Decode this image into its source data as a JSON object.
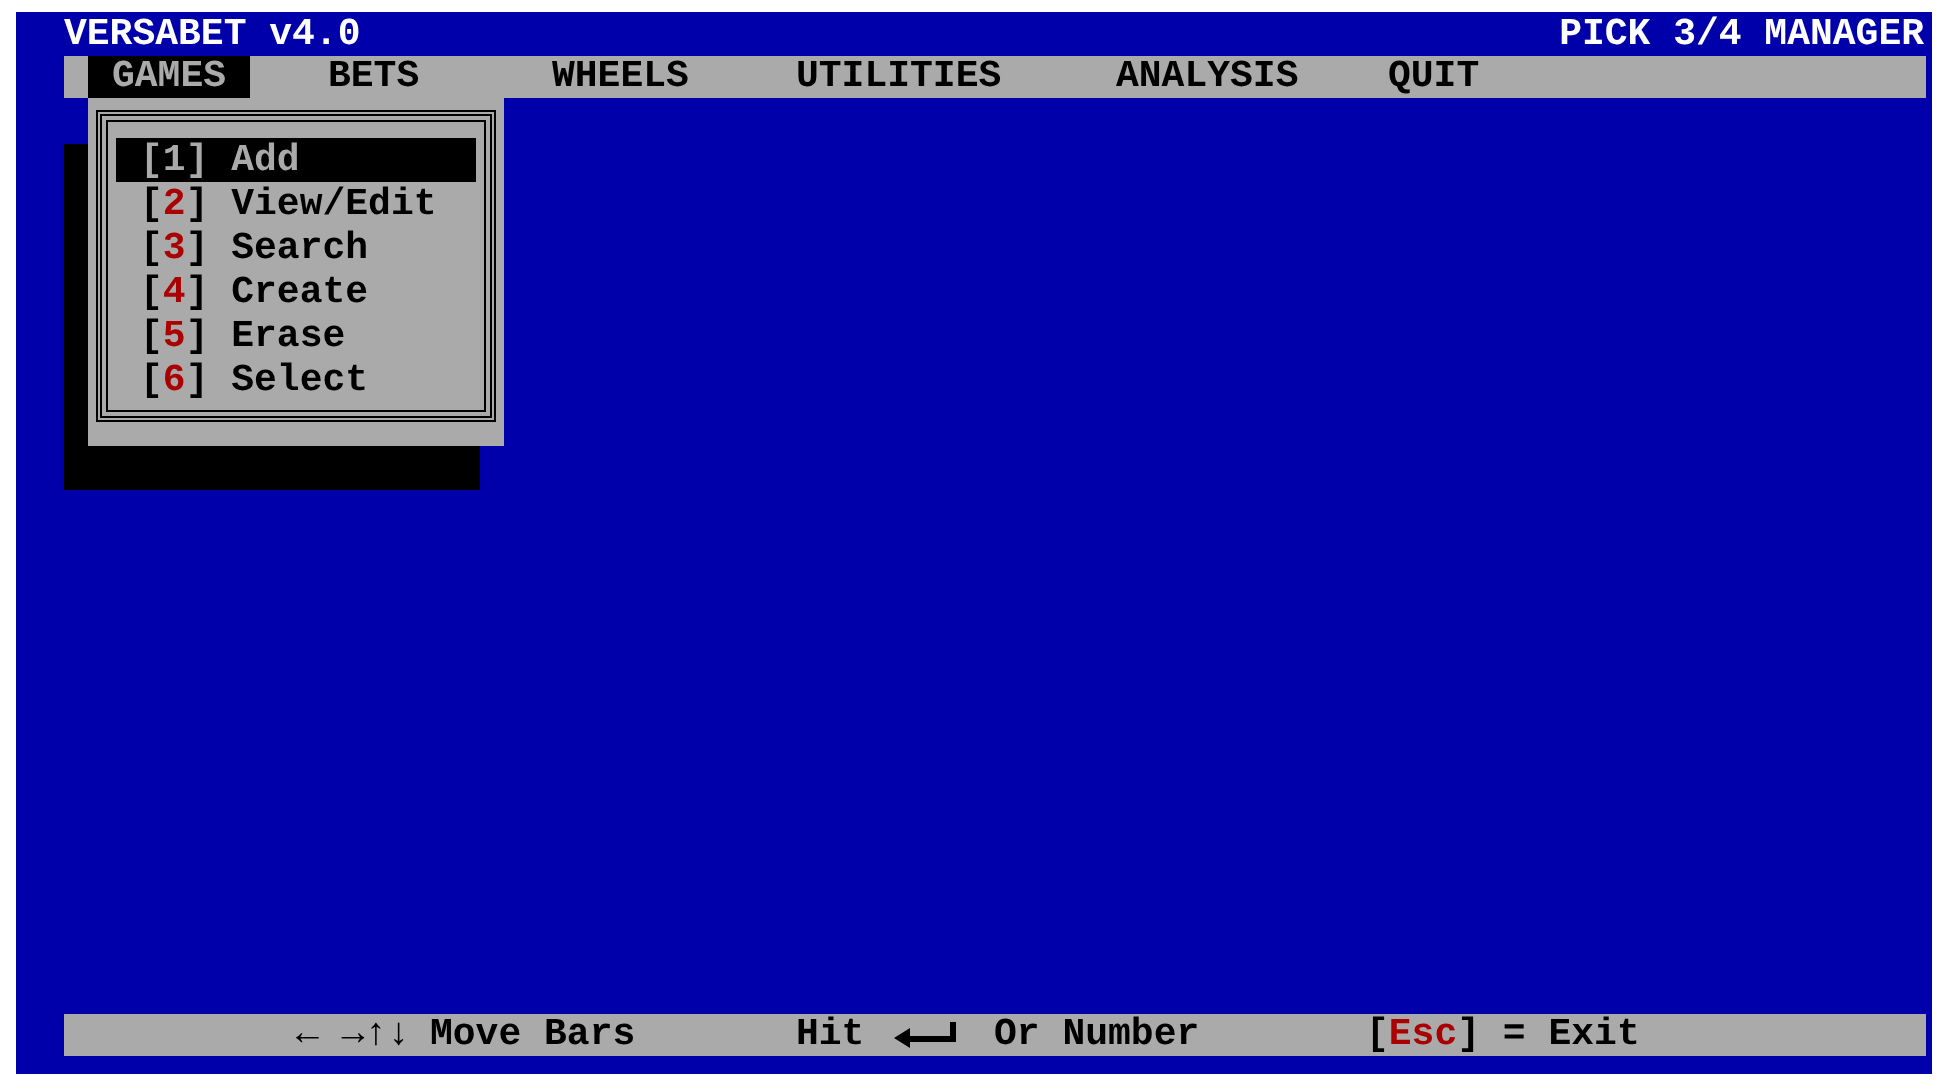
{
  "title_left": "VERSABET v4.0",
  "title_right": "PICK 3/4 MANAGER",
  "menu": [
    {
      "label": "GAMES",
      "selected": true
    },
    {
      "label": "BETS",
      "selected": false
    },
    {
      "label": "WHEELS",
      "selected": false
    },
    {
      "label": "UTILITIES",
      "selected": false
    },
    {
      "label": "ANALYSIS",
      "selected": false
    },
    {
      "label": "QUIT",
      "selected": false
    }
  ],
  "dropdown": [
    {
      "open": "[",
      "key": "1",
      "close": "]",
      "label": "Add",
      "selected": true
    },
    {
      "open": "[",
      "key": "2",
      "close": "]",
      "label": "View/Edit",
      "selected": false
    },
    {
      "open": "[",
      "key": "3",
      "close": "]",
      "label": "Search",
      "selected": false
    },
    {
      "open": "[",
      "key": "4",
      "close": "]",
      "label": "Create",
      "selected": false
    },
    {
      "open": "[",
      "key": "5",
      "close": "]",
      "label": "Erase",
      "selected": false
    },
    {
      "open": "[",
      "key": "6",
      "close": "]",
      "label": "Select",
      "selected": false
    }
  ],
  "status_bar": {
    "arrows": "← →↑↓",
    "move": "Move Bars",
    "hit": "Hit",
    "or_number": "Or Number",
    "esc_open": "[",
    "esc_key": "Esc",
    "esc_close": "] = Exit"
  }
}
